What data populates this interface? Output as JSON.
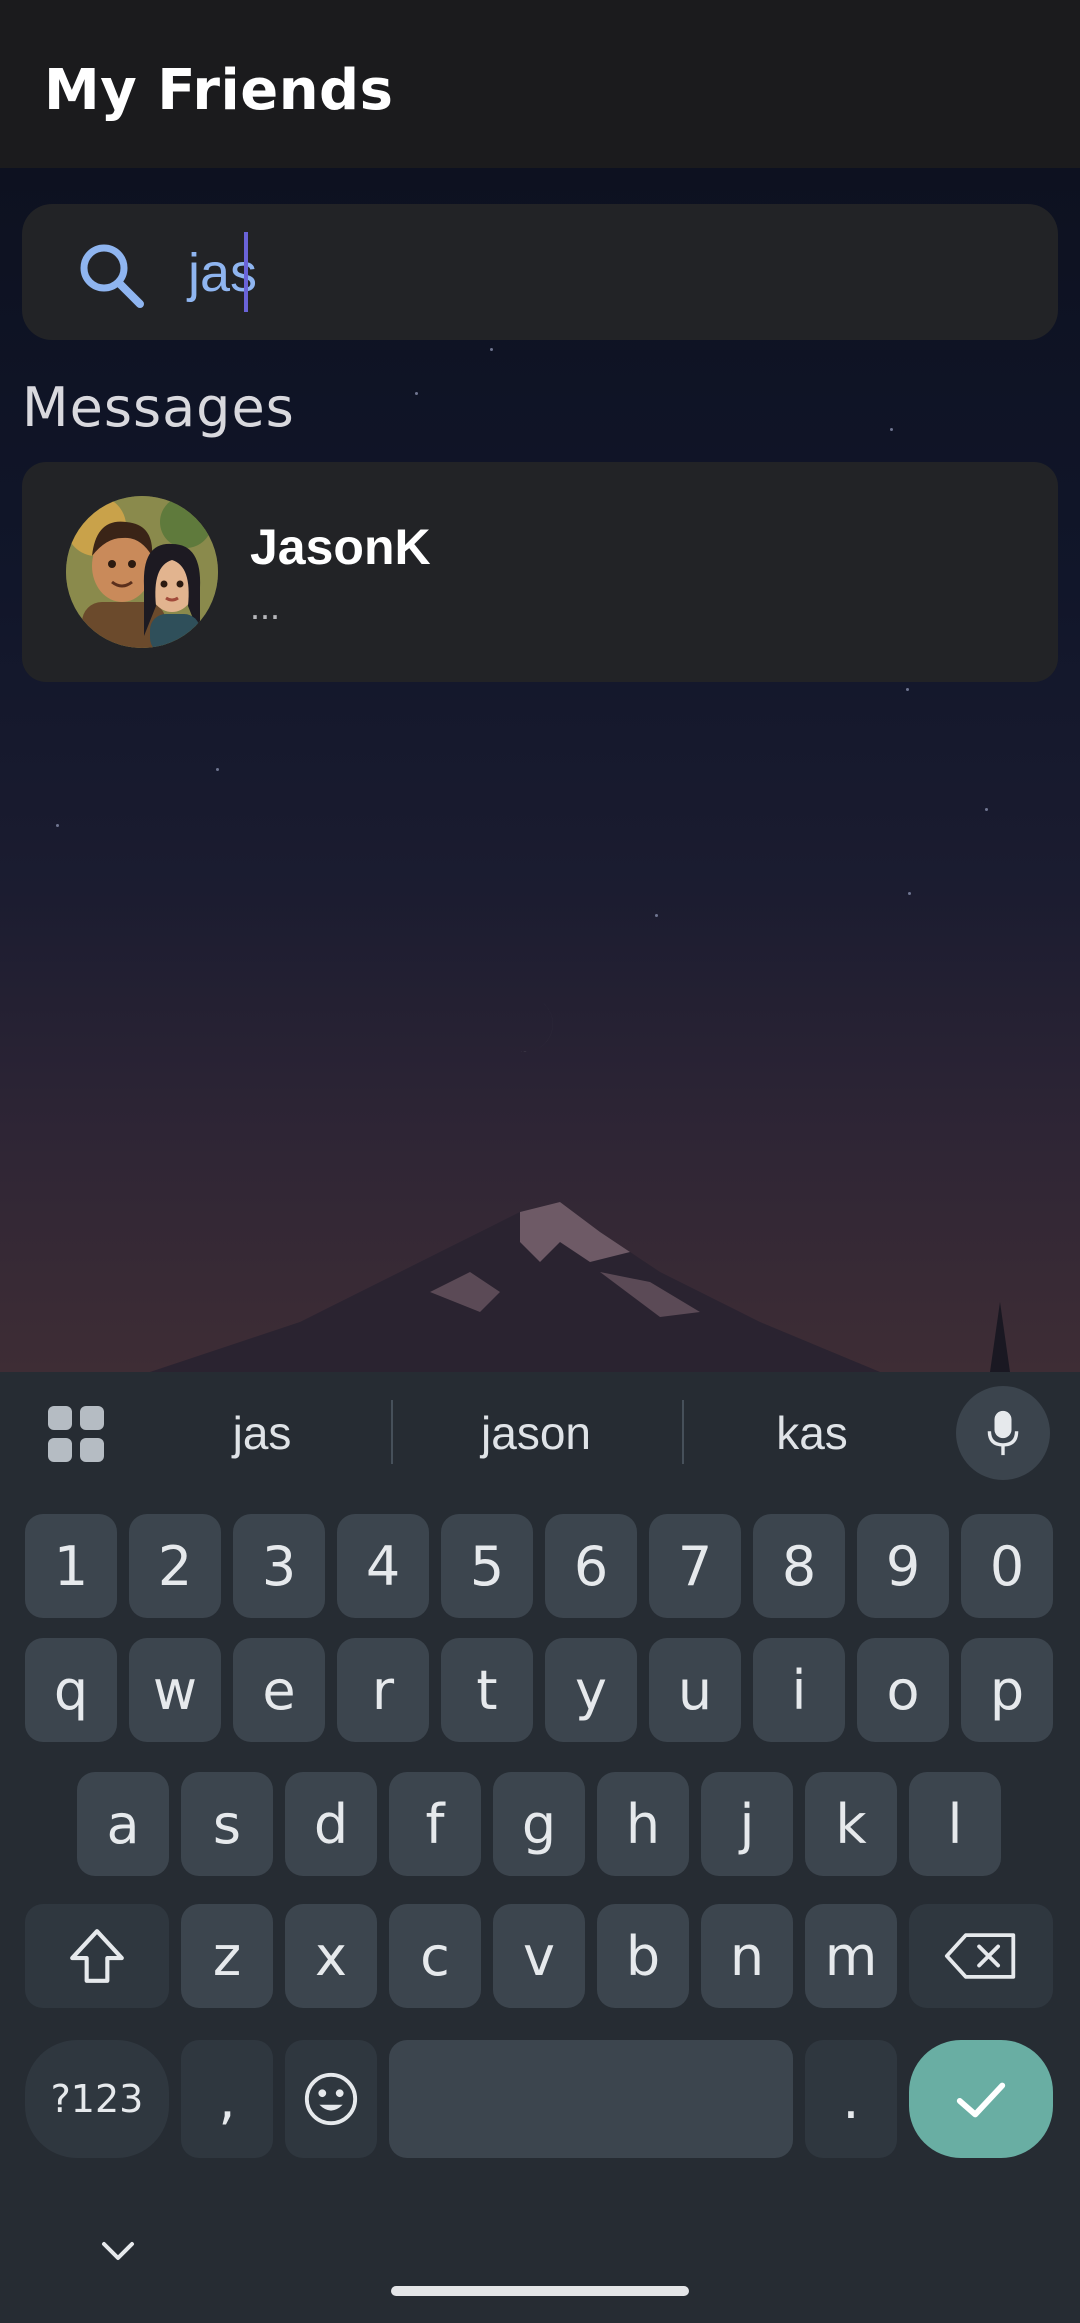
{
  "app": {
    "title": "My Friends"
  },
  "search": {
    "value": "jas",
    "placeholder": ""
  },
  "section": {
    "title": "Messages"
  },
  "contacts": [
    {
      "name": "JasonK",
      "preview": "..."
    }
  ],
  "keyboard": {
    "suggestions": [
      "jas",
      "jason",
      "kas"
    ],
    "row_numbers": [
      "1",
      "2",
      "3",
      "4",
      "5",
      "6",
      "7",
      "8",
      "9",
      "0"
    ],
    "row1": [
      "q",
      "w",
      "e",
      "r",
      "t",
      "y",
      "u",
      "i",
      "o",
      "p"
    ],
    "row2": [
      "a",
      "s",
      "d",
      "f",
      "g",
      "h",
      "j",
      "k",
      "l"
    ],
    "row3": [
      "z",
      "x",
      "c",
      "v",
      "b",
      "n",
      "m"
    ],
    "symbols_label": "?123",
    "comma": ",",
    "period": "."
  },
  "colors": {
    "accent": "#8fb5f0",
    "caret": "#6a63d8",
    "enter_key": "#69aea3"
  }
}
